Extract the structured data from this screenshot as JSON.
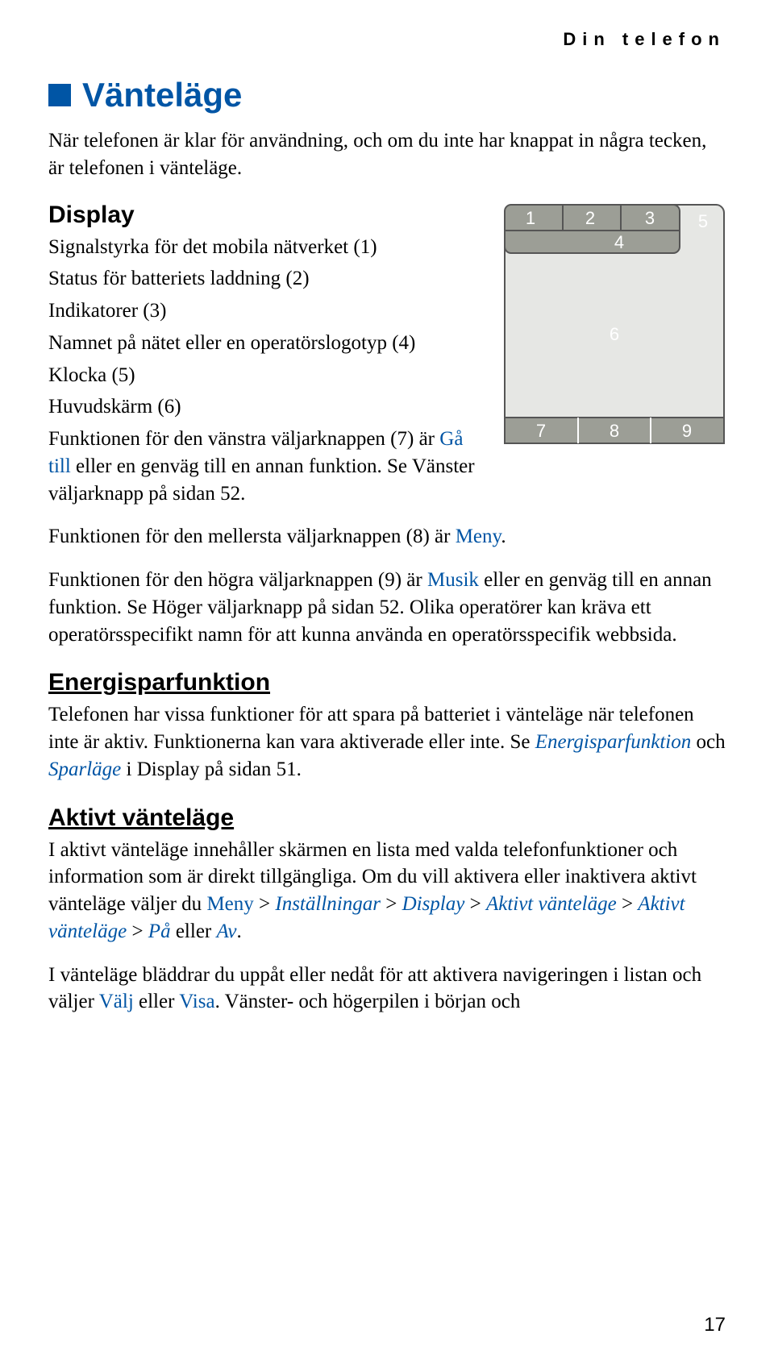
{
  "running_head": "Din telefon",
  "section_title": "Vänteläge",
  "intro": "När telefonen är klar för användning, och om du inte har knappat in några tecken, är telefonen i vänteläge.",
  "display_head": "Display",
  "display_items": [
    "Signalstyrka för det mobila nätverket (1)",
    "Status för batteriets laddning (2)",
    "Indikatorer (3)",
    "Namnet på nätet eller en operatörslogotyp (4)",
    "Klocka (5)",
    "Huvudskärm (6)"
  ],
  "f7_a": "Funktionen för den vänstra väljarknappen (7) är ",
  "f7_hi": "Gå till",
  "f7_b": " eller en genväg till en annan funktion. Se Vänster väljarknapp på sidan 52.",
  "f8_a": "Funktionen för den mellersta väljarknappen (8) är ",
  "f8_hi": "Meny",
  "f8_b": ".",
  "f9_a": "Funktionen för den högra väljarknappen (9) är ",
  "f9_hi": "Musik",
  "f9_b": " eller en genväg till en annan funktion. Se Höger väljarknapp på sidan 52. Olika operatörer kan kräva ett operatörsspecifikt namn för att kunna använda en operatörsspecifik webbsida.",
  "energy_head": "Energisparfunktion",
  "energy_a": "Telefonen har vissa funktioner för att spara på batteriet i vänteläge när telefonen inte är aktiv. Funktionerna kan vara aktiverade eller inte. Se ",
  "energy_i1": "Energisparfunktion",
  "energy_mid": " och ",
  "energy_i2": "Sparläge",
  "energy_b": " i Display på sidan 51.",
  "active_head": "Aktivt vänteläge",
  "active_a": "I aktivt vänteläge innehåller skärmen en lista med valda telefonfunktioner och information som är direkt tillgängliga. Om du vill aktivera eller inaktivera aktivt vänteläge väljer du ",
  "m_meny": "Meny",
  "gt": " > ",
  "m_inst": "Inställningar",
  "m_disp": "Display",
  "m_av1": "Aktivt vänteläge",
  "m_av2": "Aktivt vänteläge",
  "m_pa": "På",
  "m_eller": " eller ",
  "m_av": "Av",
  "active_b": "I vänteläge bläddrar du uppåt eller nedåt för att aktivera navigeringen i listan och väljer ",
  "valj": "Välj",
  "visa": "Visa",
  "active_c": ". Vänster- och högerpilen i början och",
  "diagram": {
    "n1": "1",
    "n2": "2",
    "n3": "3",
    "n4": "4",
    "n5": "5",
    "n6": "6",
    "n7": "7",
    "n8": "8",
    "n9": "9"
  },
  "page_number": "17"
}
